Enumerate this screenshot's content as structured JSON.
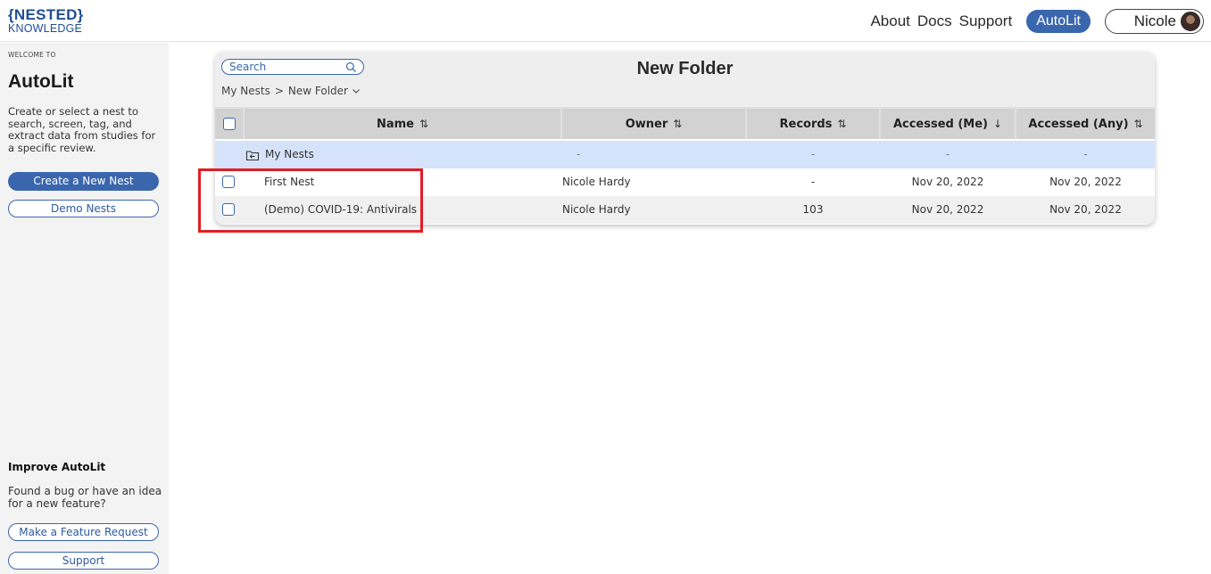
{
  "header": {
    "logo_top": "{NESTED}",
    "logo_bottom": "KNOWLEDGE",
    "nav": [
      "About",
      "Docs",
      "Support"
    ],
    "active": "AutoLit",
    "user": "Nicole"
  },
  "sidebar": {
    "welcome": "WELCOME TO",
    "title": "AutoLit",
    "description": "Create or select a nest to search, screen, tag, and extract data from studies for a specific review.",
    "create_button": "Create a New Nest",
    "demo_button": "Demo Nests",
    "improve_title": "Improve AutoLit",
    "improve_desc": "Found a bug or have an idea for a new feature?",
    "feature_button": "Make a Feature Request",
    "support_button": "Support"
  },
  "panel": {
    "search_placeholder": "Search",
    "title": "New Folder",
    "breadcrumb": [
      "My Nests",
      "New Folder"
    ],
    "columns": {
      "name": "Name",
      "owner": "Owner",
      "records": "Records",
      "accessed_me": "Accessed (Me)",
      "accessed_any": "Accessed (Any)"
    },
    "sort_icons": {
      "both": "⇅",
      "down": "↓"
    },
    "parent_row": {
      "name": "My Nests",
      "owner": "-",
      "records": "-",
      "accessed_me": "-",
      "accessed_any": "-"
    },
    "rows": [
      {
        "name": "First Nest",
        "owner": "Nicole Hardy",
        "records": "-",
        "accessed_me": "Nov 20, 2022",
        "accessed_any": "Nov 20, 2022"
      },
      {
        "name": "(Demo) COVID-19: Antivirals",
        "owner": "Nicole Hardy",
        "records": "103",
        "accessed_me": "Nov 20, 2022",
        "accessed_any": "Nov 20, 2022"
      }
    ]
  },
  "colors": {
    "accent": "#3a66ad",
    "highlight": "#e21d24",
    "folder_row": "#d5e3fa"
  }
}
